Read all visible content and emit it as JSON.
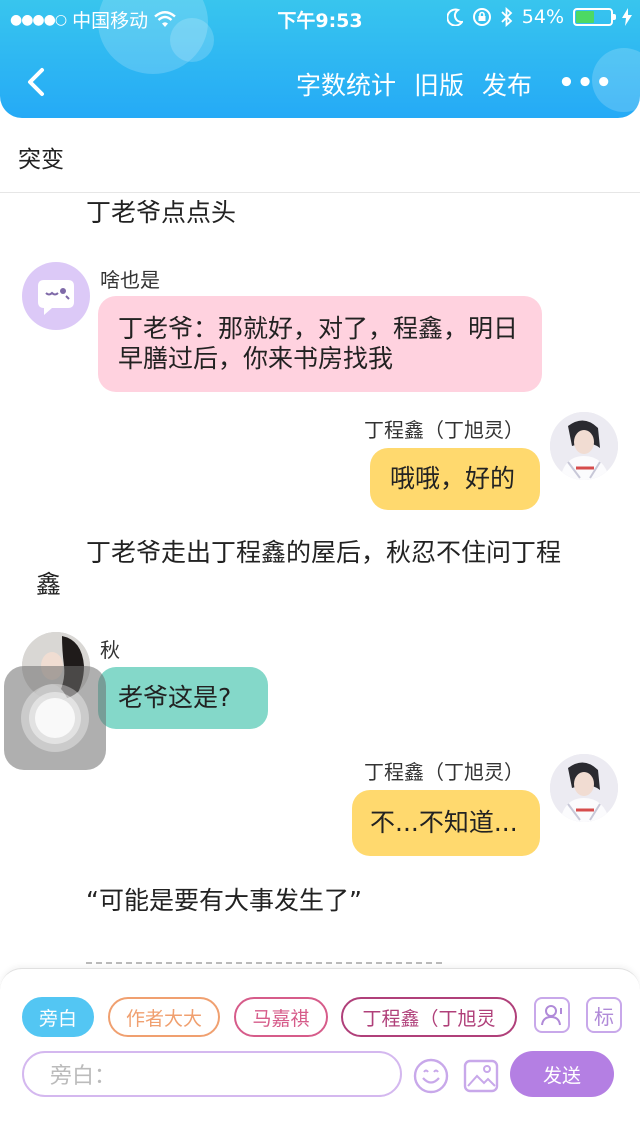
{
  "status_bar": {
    "carrier": "中国移动",
    "time": "下午9:53",
    "battery_text": "54%",
    "battery_level": 0.54
  },
  "nav": {
    "items": [
      "字数统计",
      "旧版",
      "发布"
    ],
    "more": "•••"
  },
  "chapter_title": "突变",
  "messages": [
    {
      "kind": "narration",
      "text": "丁老爷点点头"
    },
    {
      "kind": "chat",
      "name": "啥也是",
      "text": "丁老爷：那就好，对了，程鑫，明日早膳过后，你来书房找我"
    },
    {
      "kind": "chat",
      "name": "丁程鑫（丁旭灵）",
      "text": "哦哦，好的"
    },
    {
      "kind": "narration",
      "line1": "丁老爷走出丁程鑫的屋后，秋忍不住问丁程",
      "line2": "鑫"
    },
    {
      "kind": "chat",
      "name": "秋",
      "text": "老爷这是?"
    },
    {
      "kind": "chat",
      "name": "丁程鑫（丁旭灵）",
      "text": "不...不知道..."
    },
    {
      "kind": "narration",
      "text": "“可能是要有大事发生了”"
    }
  ],
  "toolbar": {
    "chips": [
      "旁白",
      "作者大大",
      "马嘉祺",
      "丁程鑫（丁旭灵"
    ],
    "tag_icon_label": "标",
    "input_placeholder": "旁白：",
    "send_label": "发送"
  },
  "colors": {
    "header": "#25aaf6",
    "pink_bubble": "#ffd2df",
    "yellow_bubble": "#ffd96e",
    "teal_bubble": "#84d8c9",
    "send_button": "#b47fe3"
  }
}
